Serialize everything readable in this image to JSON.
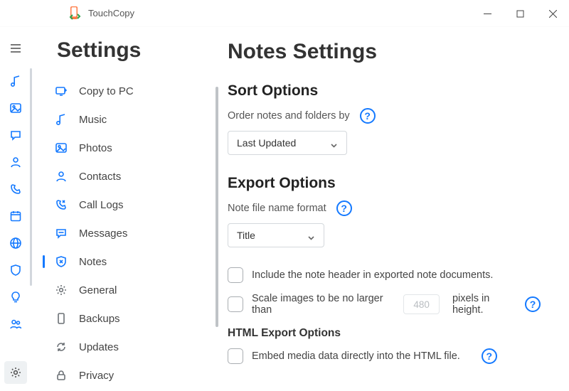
{
  "app": {
    "title": "TouchCopy"
  },
  "rail": {
    "items": [
      "music",
      "photos",
      "messages",
      "contacts",
      "calls",
      "calendar",
      "internet",
      "shield",
      "tips",
      "people"
    ]
  },
  "sidebar": {
    "title": "Settings",
    "items": [
      {
        "id": "copy",
        "label": "Copy to PC"
      },
      {
        "id": "music",
        "label": "Music"
      },
      {
        "id": "photos",
        "label": "Photos"
      },
      {
        "id": "contacts",
        "label": "Contacts"
      },
      {
        "id": "calls",
        "label": "Call Logs"
      },
      {
        "id": "messages",
        "label": "Messages"
      },
      {
        "id": "notes",
        "label": "Notes",
        "active": true
      },
      {
        "id": "general",
        "label": "General"
      },
      {
        "id": "backups",
        "label": "Backups"
      },
      {
        "id": "updates",
        "label": "Updates"
      },
      {
        "id": "privacy",
        "label": "Privacy"
      }
    ]
  },
  "main": {
    "title": "Notes Settings",
    "sort": {
      "heading": "Sort Options",
      "label": "Order notes and folders by",
      "value": "Last Updated"
    },
    "export": {
      "heading": "Export Options",
      "name_label": "Note file name format",
      "name_value": "Title",
      "include_header": "Include the note header in exported note documents.",
      "scale_prefix": "Scale images to be no larger than",
      "scale_value": "480",
      "scale_suffix": "pixels in height.",
      "html_heading": "HTML Export Options",
      "embed": "Embed media data directly into the HTML file."
    }
  }
}
